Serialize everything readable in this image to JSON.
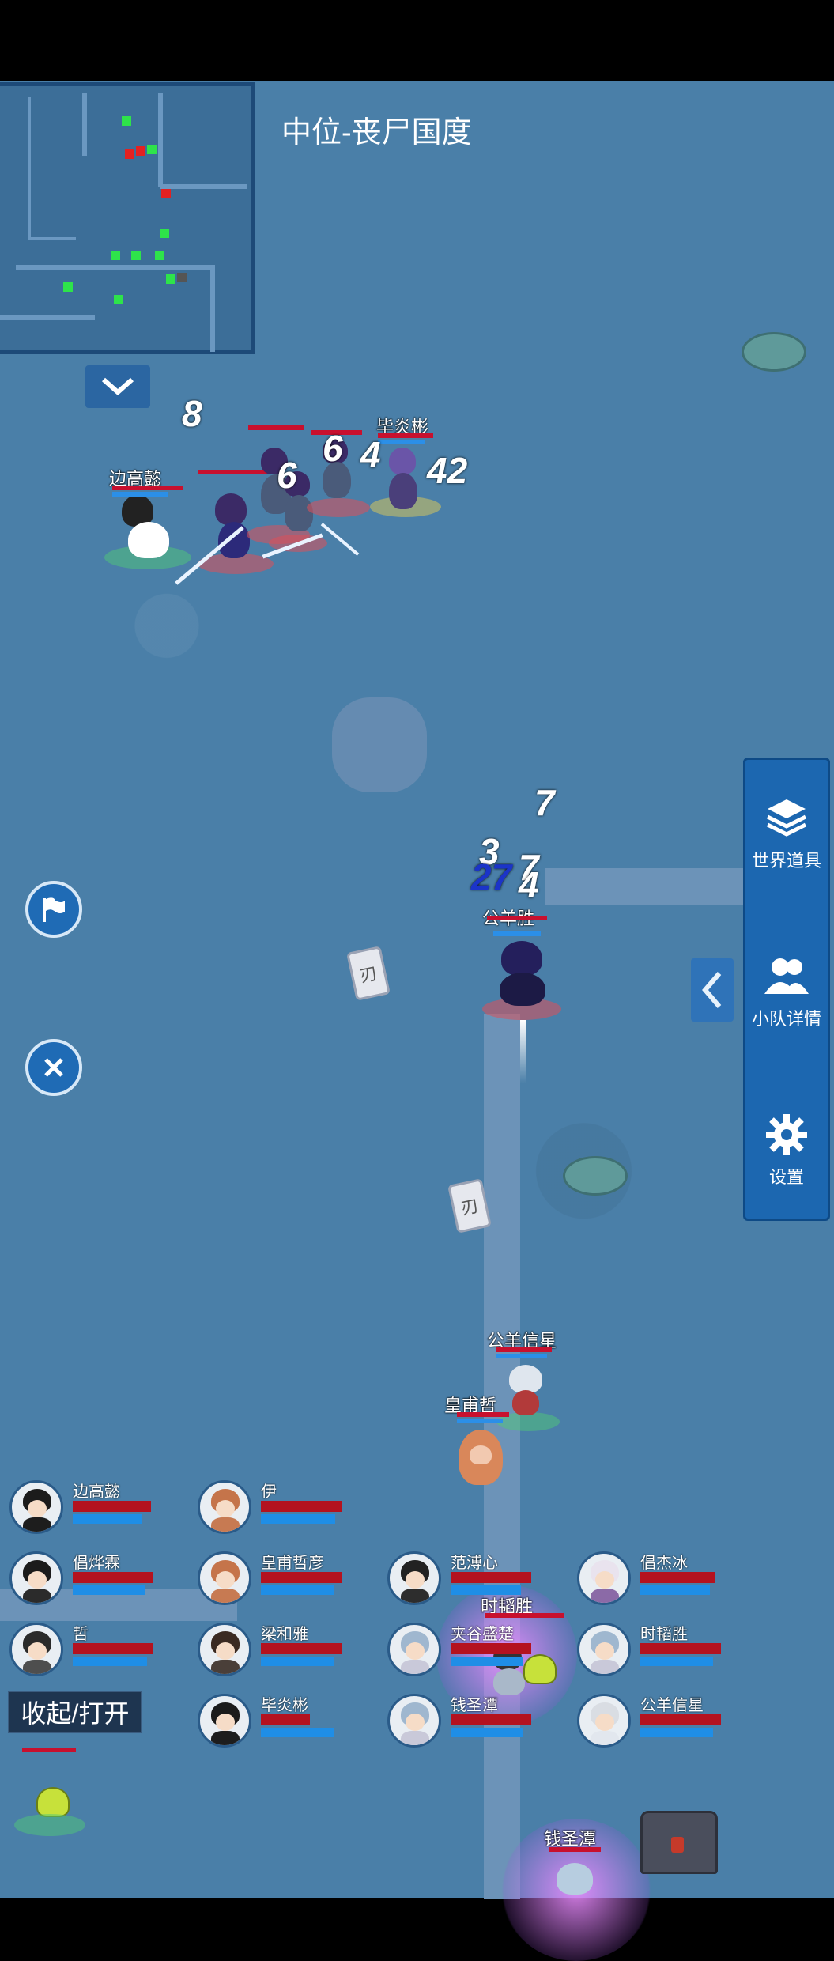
{
  "map_title": "中位-丧尸国度",
  "side_panel": {
    "world_items": "世界道具",
    "team_details": "小队详情",
    "settings": "设置"
  },
  "toggle_button": "收起/打开",
  "field_labels": {
    "bian_gao_yi": "边高懿",
    "bi_yan_bin": "毕炎彬",
    "gongyang_xingxing": "公羊信星",
    "huangfu_zhe": "皇甫哲",
    "shi_taosheng": "时韬胜",
    "qian_shengtan": "钱圣潭",
    "zhu_nobody": "公羊胜"
  },
  "damage_numbers": {
    "d1": "8",
    "d2": "6",
    "d3": "6",
    "d4": "4",
    "d5": "42",
    "d6": "7",
    "d7": "3",
    "d8": "27",
    "d9": "7",
    "d10": "4"
  },
  "card_glyph": "刃",
  "team": [
    {
      "name": "边高懿",
      "hp": 0.95,
      "mp": 0.85
    },
    {
      "name": "伊",
      "hp": 0.98,
      "mp": 0.9
    },
    {
      "name": "倡烨霖",
      "hp": 0.98,
      "mp": 0.88
    },
    {
      "name": "皇甫哲彦",
      "hp": 0.98,
      "mp": 0.88
    },
    {
      "name": "范溥心",
      "hp": 0.98,
      "mp": 0.86
    },
    {
      "name": "倡杰冰",
      "hp": 0.9,
      "mp": 0.85
    },
    {
      "name": "哲",
      "hp": 0.98,
      "mp": 0.9
    },
    {
      "name": "梁和雅",
      "hp": 0.98,
      "mp": 0.88
    },
    {
      "name": "夹谷盛楚",
      "hp": 0.98,
      "mp": 0.88
    },
    {
      "name": "时韬胜",
      "hp": 0.98,
      "mp": 0.88
    },
    {
      "name": "毕炎彬",
      "hp": 0.6,
      "mp": 0.88
    },
    {
      "name": "钱圣潭",
      "hp": 0.98,
      "mp": 0.88
    },
    {
      "name": "公羊信星",
      "hp": 0.98,
      "mp": 0.88
    }
  ]
}
